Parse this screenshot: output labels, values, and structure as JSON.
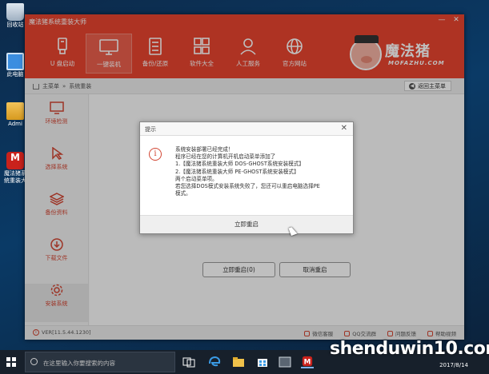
{
  "desktop": {
    "icons": [
      {
        "label": "回收站"
      },
      {
        "label": "此电脑"
      },
      {
        "label": "Admi"
      },
      {
        "label": "魔法猪系统重装大"
      }
    ]
  },
  "window": {
    "title": "魔法猪系统重装大师",
    "controls": {
      "minimize": "—",
      "close": "✕"
    },
    "nav": [
      {
        "label": "U 盘启动",
        "icon": "usb-icon"
      },
      {
        "label": "一键装机",
        "icon": "computer-icon"
      },
      {
        "label": "备份/还原",
        "icon": "backup-icon"
      },
      {
        "label": "软件大全",
        "icon": "apps-icon"
      },
      {
        "label": "人工服务",
        "icon": "service-icon"
      },
      {
        "label": "官方网站",
        "icon": "globe-icon"
      }
    ],
    "logo": {
      "text": "魔法猪",
      "sub": "MOFAZHU.COM"
    },
    "breadcrumb": {
      "home": "主菜单",
      "separator": "»",
      "current": "系统重装"
    },
    "back_button": "返回主菜单",
    "sidebar": [
      {
        "label": "环境检测",
        "icon": "monitor-icon"
      },
      {
        "label": "选择系统",
        "icon": "pointer-icon"
      },
      {
        "label": "备份资料",
        "icon": "layers-icon"
      },
      {
        "label": "下载文件",
        "icon": "download-icon"
      },
      {
        "label": "安装系统",
        "icon": "settings-icon"
      }
    ],
    "actions": {
      "restart_now": "立即重启(0)",
      "cancel_restart": "取消重启"
    },
    "footer": {
      "version": "VER[11.5.44.1230]",
      "links": [
        "微信客服",
        "QQ交流群",
        "问题反馈",
        "帮助视频"
      ]
    }
  },
  "dialog": {
    "title": "提示",
    "close": "✕",
    "icon": "info-icon",
    "lines": [
      "系统安装部署已经完成！",
      "程序已经在您的计算机开机启动菜单添加了",
      "1.【魔法猪系统重装大师 DOS-GHOST系统安装模式】",
      "2.【魔法猪系统重装大师 PE-GHOST系统安装模式】",
      "两个启动菜单项。",
      "若您选择DOS模式安装系统失败了，您还可以重启电脑选择PE",
      "模式。"
    ],
    "button": "立即重启"
  },
  "taskbar": {
    "search_placeholder": "在这里输入你要搜索的内容",
    "date": "2017/8/14"
  },
  "watermark": "shenduwin10.com"
}
